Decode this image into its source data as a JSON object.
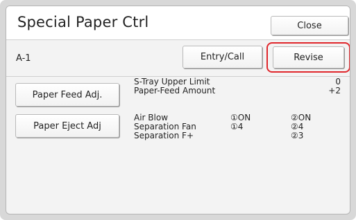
{
  "header": {
    "title": "Special Paper Ctrl",
    "close_label": "Close"
  },
  "toolbar": {
    "memory_label": "A-1",
    "entry_call_label": "Entry/Call",
    "revise_label": "Revise"
  },
  "paper_feed": {
    "button_label": "Paper Feed Adj.",
    "rows": [
      {
        "label": "S-Tray Upper Limit",
        "value": "0"
      },
      {
        "label": "Paper-Feed Amount",
        "value": "+2"
      }
    ]
  },
  "paper_eject": {
    "button_label": "Paper Eject Adj",
    "rows": [
      {
        "label": "Air Blow",
        "col1": "①ON",
        "col2": "②ON"
      },
      {
        "label": "Separation Fan",
        "col1": "①4",
        "col2": "②4"
      },
      {
        "label": "Separation F+",
        "col1": "",
        "col2": "②3"
      }
    ]
  },
  "colors": {
    "highlight": "#e0262b"
  }
}
